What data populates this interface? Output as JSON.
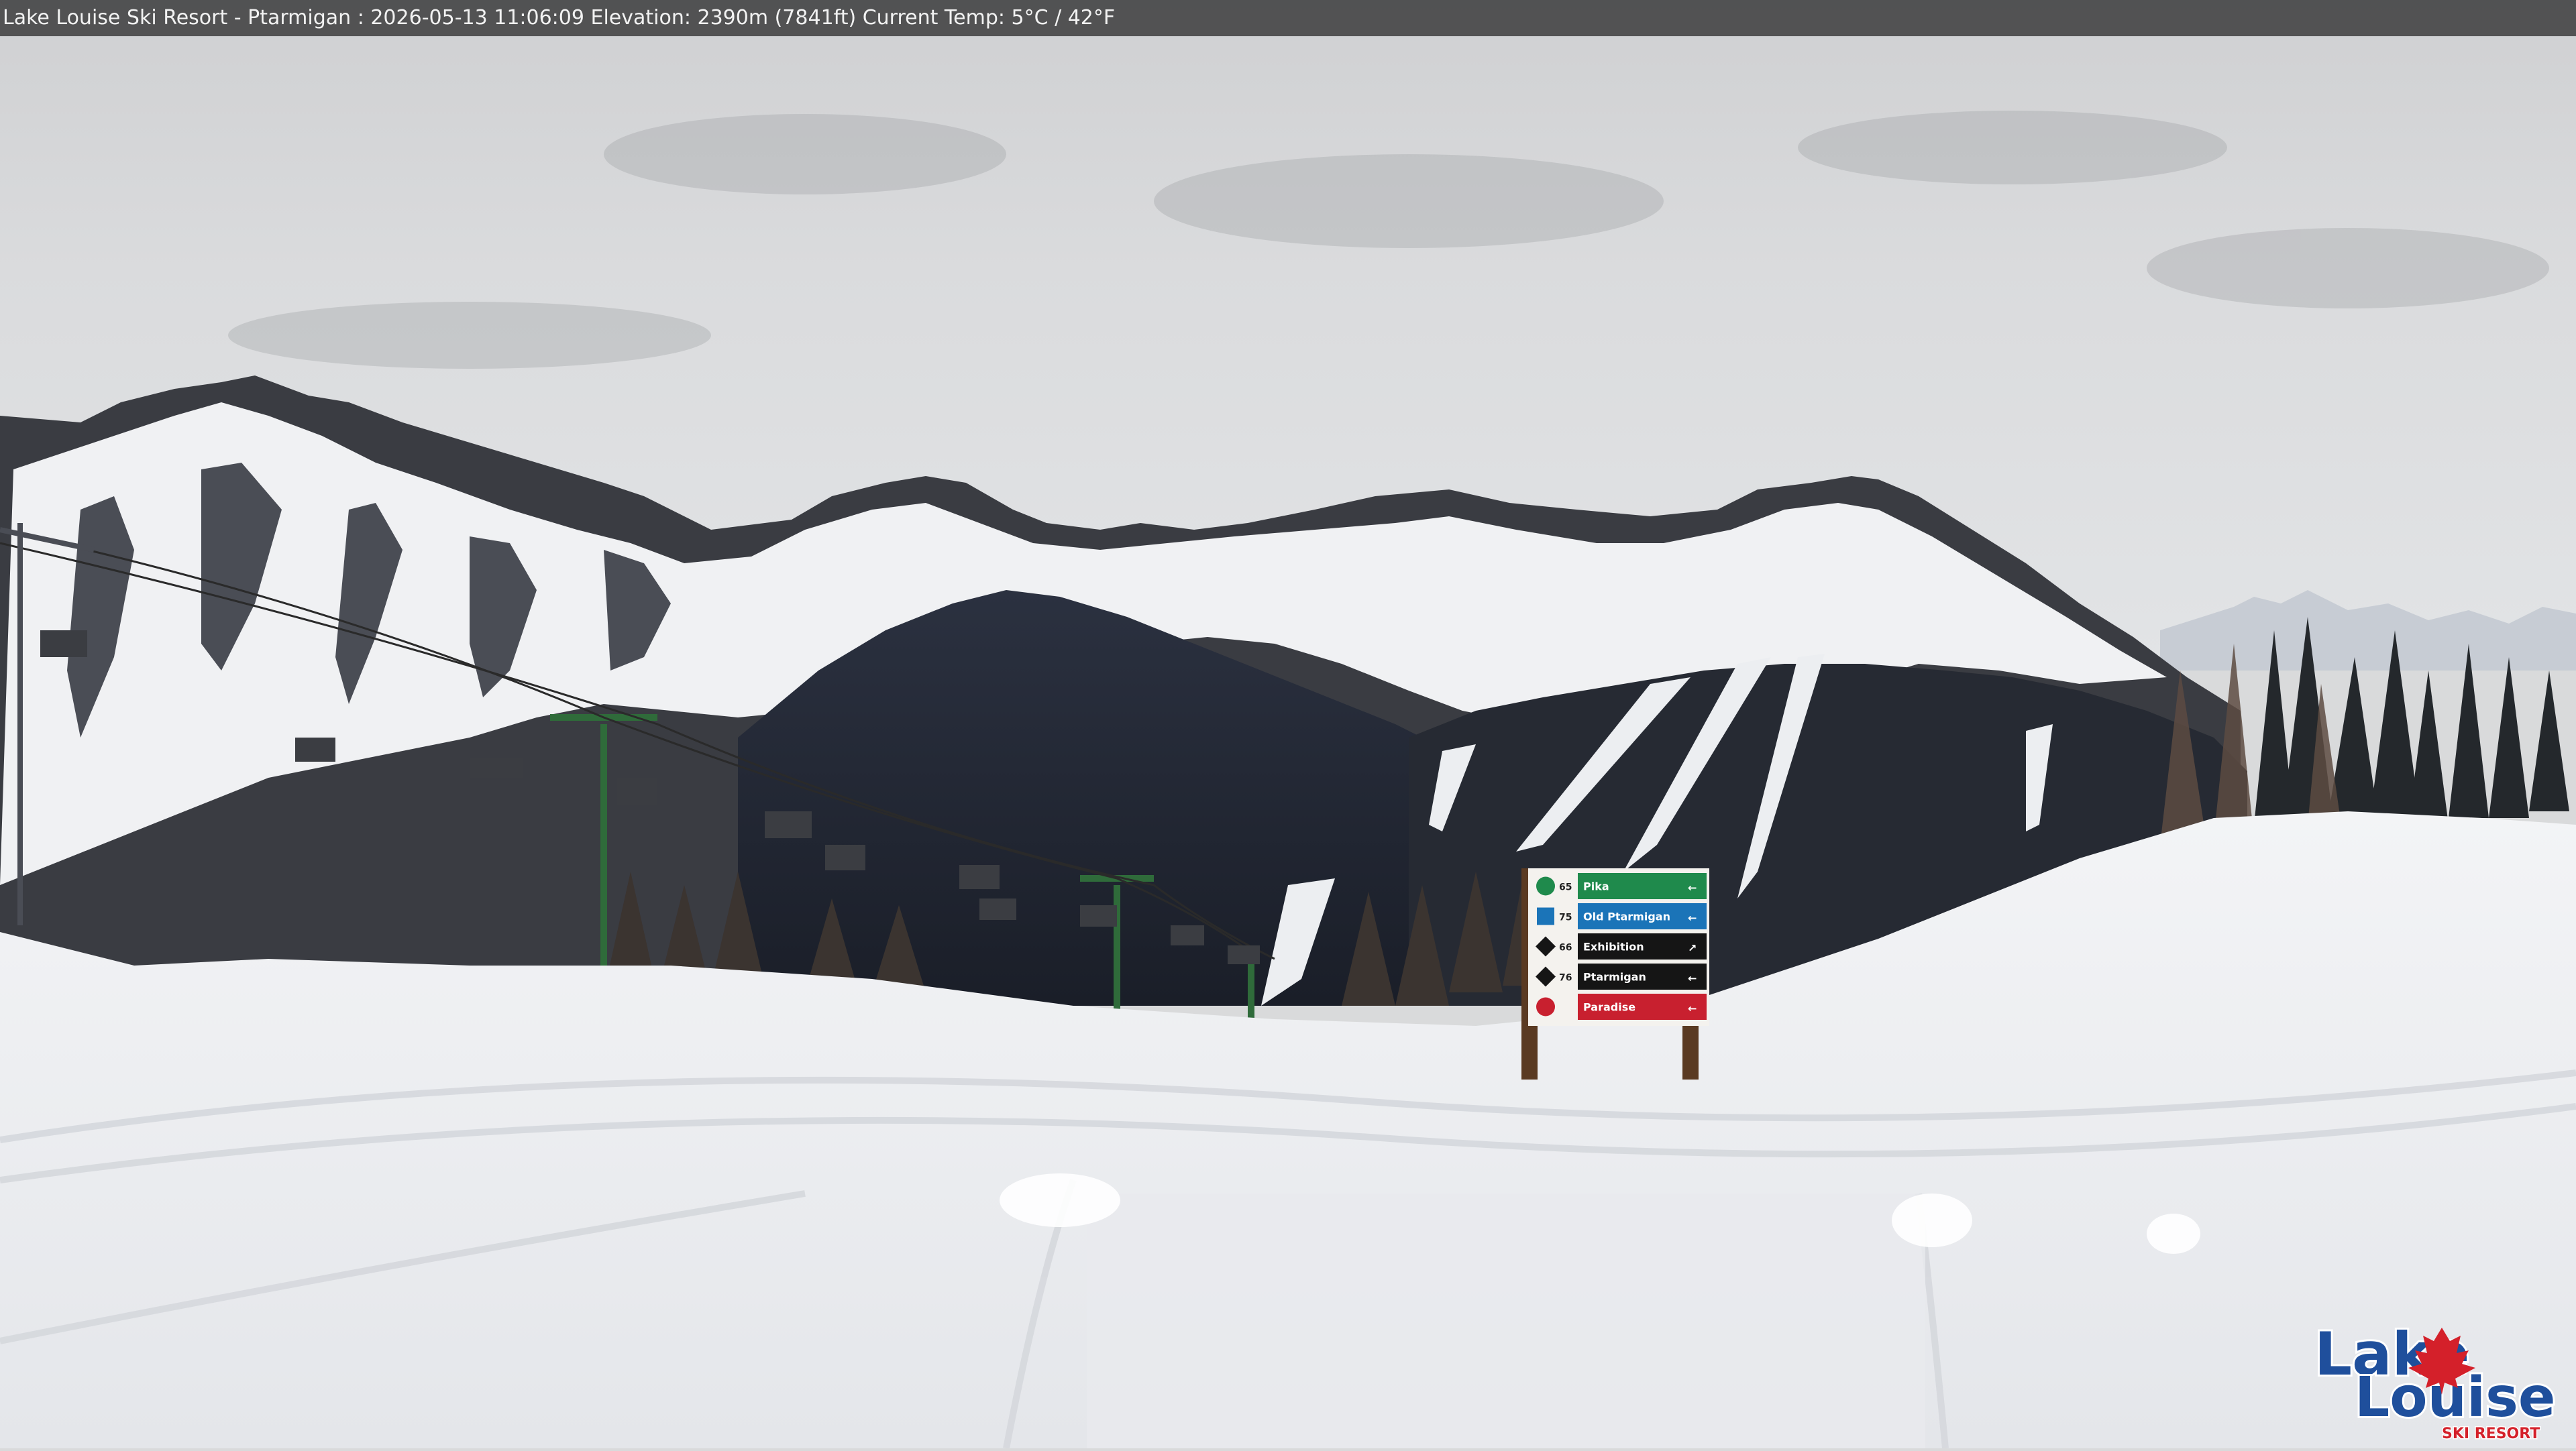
{
  "caption": {
    "text": "Lake Louise Ski Resort - Ptarmigan : 2026-05-13 11:06:09  Elevation: 2390m (7841ft) Current Temp: 5°C / 42°F"
  },
  "trail_sign": {
    "rows": [
      {
        "number": "65",
        "name": "Pika",
        "color": "#1f8a4c",
        "difficulty_icon": "green-circle-icon",
        "arrow": "←"
      },
      {
        "number": "75",
        "name": "Old Ptarmigan",
        "color": "#1b74b8",
        "difficulty_icon": "blue-square-icon",
        "arrow": "←"
      },
      {
        "number": "66",
        "name": "Exhibition",
        "color": "#151515",
        "difficulty_icon": "black-diamond-icon",
        "arrow": "↗"
      },
      {
        "number": "76",
        "name": "Ptarmigan",
        "color": "#151515",
        "difficulty_icon": "black-diamond-icon",
        "arrow": "←"
      },
      {
        "number": "",
        "name": "Paradise",
        "color": "#c8202f",
        "difficulty_icon": "lodge-icon",
        "arrow": "←"
      }
    ]
  },
  "logo": {
    "line1": "Lake",
    "line2": "Louise",
    "line3": "SKI RESORT",
    "brand_color": "#1f4f9c",
    "accent_color": "#d4202a"
  }
}
